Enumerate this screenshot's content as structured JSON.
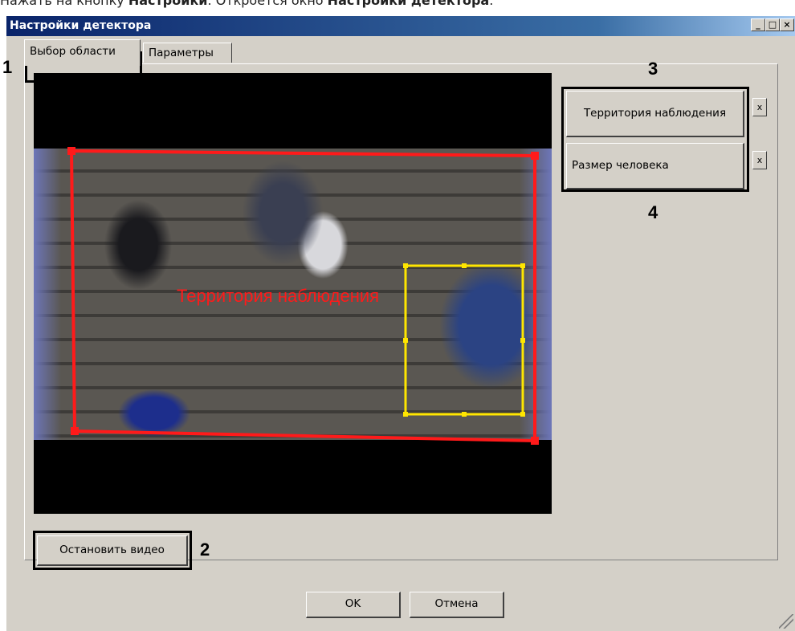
{
  "instruction": {
    "text_prefix": "Нажать на кнопку ",
    "bold_1": "Настройки",
    "text_middle": ". Откроется окно ",
    "bold_2": "Настройки детектора",
    "text_suffix": "."
  },
  "window": {
    "title": "Настройки детектора",
    "minimize_label": "_",
    "maximize_label": "□",
    "close_label": "×"
  },
  "tabs": [
    {
      "label": "Выбор области",
      "active": true
    },
    {
      "label": "Параметры",
      "active": false
    }
  ],
  "video": {
    "overlay_label": "Территория наблюдения",
    "zone_color": "#ff1a1a",
    "person_box_color": "#ffe600"
  },
  "side_buttons": [
    {
      "label": "Территория наблюдения",
      "clear_label": "x"
    },
    {
      "label": "Размер человека",
      "clear_label": "x"
    }
  ],
  "stop_button": "Остановить видео",
  "dialog_buttons": {
    "ok": "OK",
    "cancel": "Отмена"
  },
  "annotations": {
    "n1": "1",
    "n2": "2",
    "n3": "3",
    "n4": "4"
  },
  "colors": {
    "titlebar": "#0a246a",
    "face": "#d4d0c8"
  }
}
